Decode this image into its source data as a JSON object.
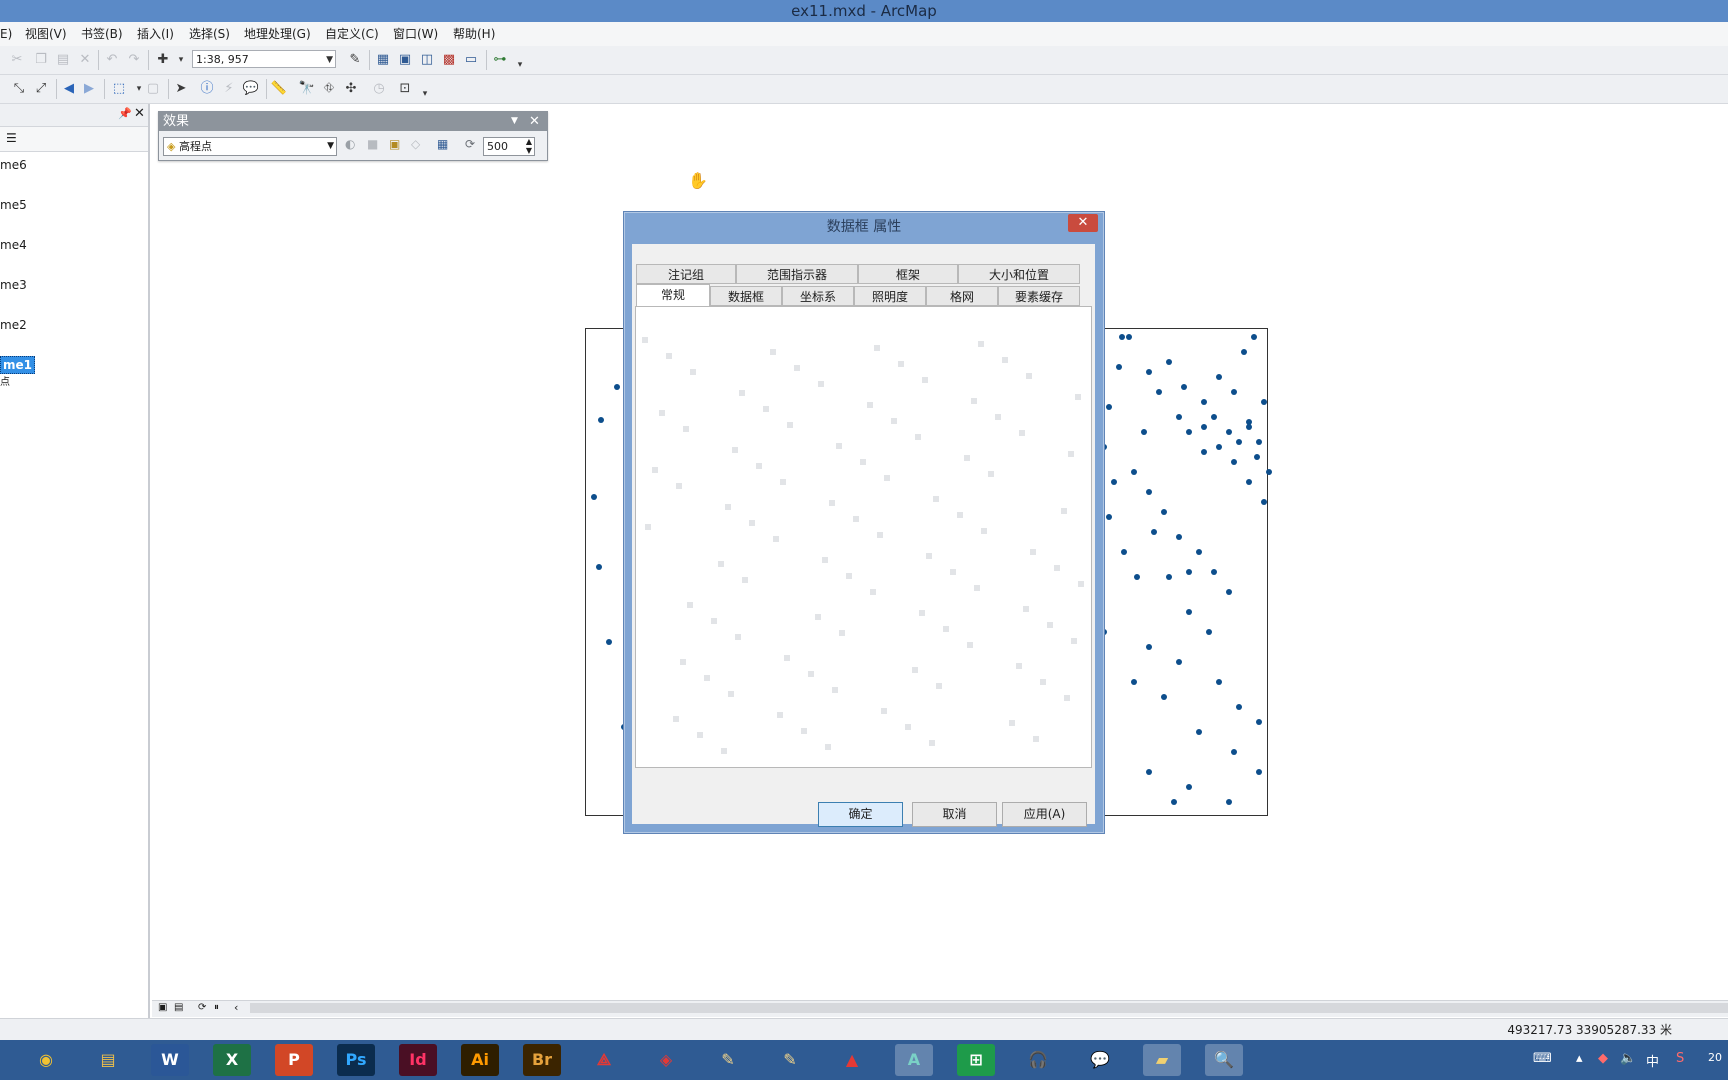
{
  "window": {
    "title": "ex11.mxd - ArcMap"
  },
  "menu": [
    "E)",
    "视图(V)",
    "书签(B)",
    "插入(I)",
    "选择(S)",
    "地理处理(G)",
    "自定义(C)",
    "窗口(W)",
    "帮助(H)"
  ],
  "toolbar": {
    "scale": "1:38, 957",
    "icons": [
      "cut-icon",
      "copy-icon",
      "paste-icon",
      "delete-icon",
      "undo-icon",
      "redo-icon",
      "add-data-icon",
      "editor-icon",
      "toc-window-icon",
      "catalog-icon",
      "search-icon",
      "arctoolbox-icon",
      "python-icon",
      "model-builder-icon"
    ]
  },
  "toc": {
    "items": [
      "me6",
      "me5",
      "me4",
      "me3",
      "me2",
      "me1",
      "点"
    ],
    "selected": "me1"
  },
  "effects": {
    "title": "效果",
    "layer": "高程点",
    "contrast": "500"
  },
  "dialog": {
    "title": "数据框 属性",
    "tabs_row1": [
      "注记组",
      "范围指示器",
      "框架",
      "大小和位置"
    ],
    "tabs_row2": [
      "常规",
      "数据框",
      "坐标系",
      "照明度",
      "格网",
      "要素缓存"
    ],
    "active_tab": "常规",
    "buttons": {
      "ok": "确定",
      "cancel": "取消",
      "apply": "应用(A)"
    }
  },
  "status": {
    "coordinates": "493217.73  33905287.33 米"
  },
  "taskbar": {
    "apps": [
      "chrome",
      "explorer",
      "W",
      "X",
      "P",
      "Ps",
      "Id",
      "Ai",
      "Br",
      "acrobat",
      "cad",
      "pen",
      "pen2",
      "autocad",
      "arcgis",
      "excel-green",
      "headphones",
      "wechat",
      "folder",
      "search"
    ],
    "tray_input": "中",
    "clock": "20"
  },
  "colors": {
    "titlebar": "#5b8ac7",
    "point": "#0d4e8c",
    "selection": "#3390e6",
    "dialog_frame": "#7fa4d3"
  }
}
